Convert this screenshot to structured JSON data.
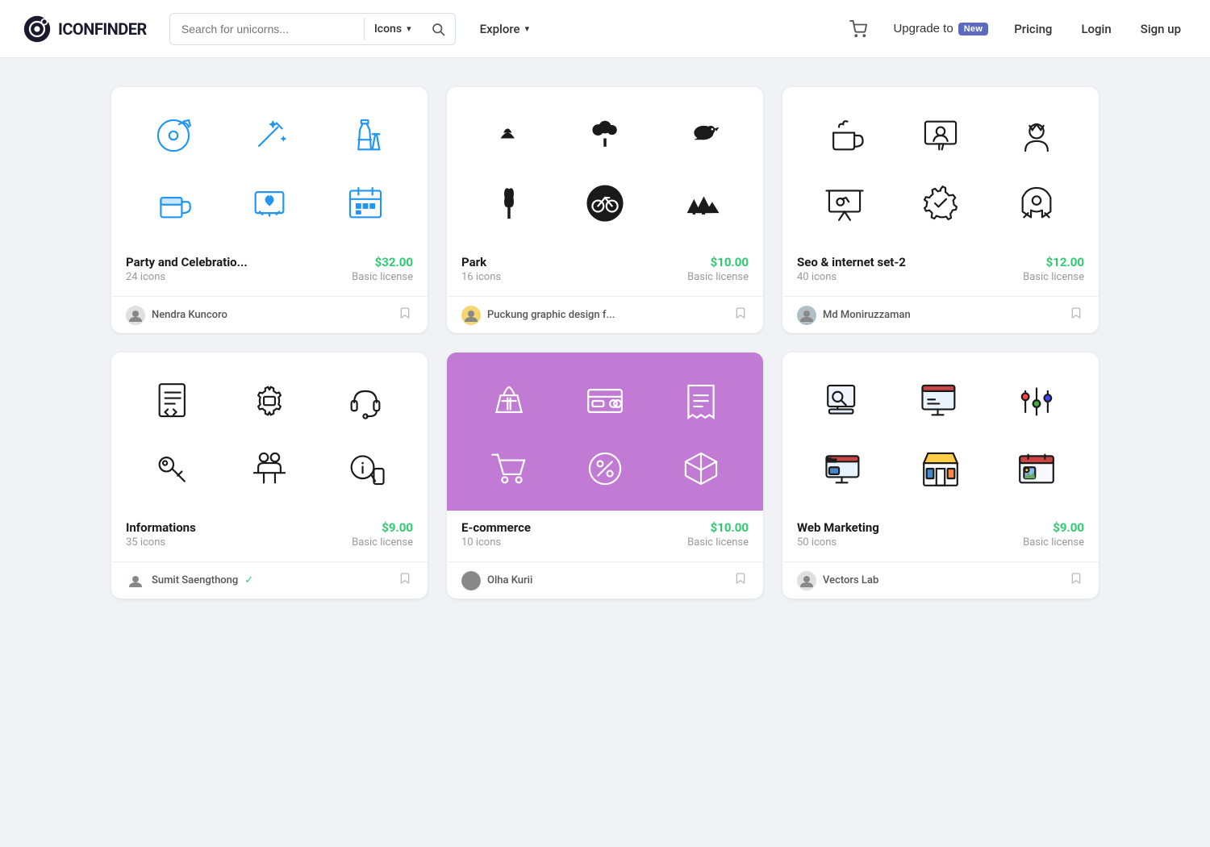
{
  "header": {
    "logo_text": "ICONFINDER",
    "search_placeholder": "Search for unicorns...",
    "icons_label": "Icons",
    "explore_label": "Explore",
    "upgrade_label": "Upgrade to",
    "new_badge": "New",
    "pricing_label": "Pricing",
    "login_label": "Login",
    "signup_label": "Sign up"
  },
  "cards": [
    {
      "id": "party",
      "name": "Party and Celebratio...",
      "icon_count": "24 icons",
      "price": "$32.00",
      "license": "Basic license",
      "author": "Nendra Kuncoro",
      "bg": "white",
      "icons": [
        "🎵",
        "✨",
        "🍾",
        "🍺",
        "💌",
        "📅"
      ]
    },
    {
      "id": "park",
      "name": "Park",
      "icon_count": "16 icons",
      "price": "$10.00",
      "license": "Basic license",
      "author": "Puckung graphic design f...",
      "bg": "white",
      "icons": [
        "🌷",
        "🌳",
        "🐦",
        "🌿",
        "🚲",
        "🌲"
      ]
    },
    {
      "id": "seo",
      "name": "Seo & internet set-2",
      "icon_count": "40 icons",
      "price": "$12.00",
      "license": "Basic license",
      "author": "Md Moniruzzaman",
      "bg": "white",
      "icons": [
        "☕",
        "💻",
        "👑",
        "📊",
        "⚙️",
        "🚀"
      ]
    },
    {
      "id": "informations",
      "name": "Informations",
      "icon_count": "35 icons",
      "price": "$9.00",
      "license": "Basic license",
      "author": "Sumit Saengthong",
      "verified": true,
      "bg": "white",
      "icons": [
        "📋",
        "⚙️",
        "🎧",
        "🔧",
        "👥",
        "💬"
      ]
    },
    {
      "id": "ecommerce",
      "name": "E-commerce",
      "icon_count": "10 icons",
      "price": "$10.00",
      "license": "Basic license",
      "author": "Olha Kurii",
      "bg": "purple",
      "icons": [
        "🛒",
        "💳",
        "🧾",
        "🛒",
        "🏷️",
        "📦"
      ]
    },
    {
      "id": "webmarketing",
      "name": "Web Marketing",
      "icon_count": "50 icons",
      "price": "$9.00",
      "license": "Basic license",
      "author": "Vectors Lab",
      "bg": "white",
      "icons": [
        "🔍",
        "💻",
        "🎛️",
        "🖥️",
        "🏪",
        "📅"
      ]
    }
  ]
}
